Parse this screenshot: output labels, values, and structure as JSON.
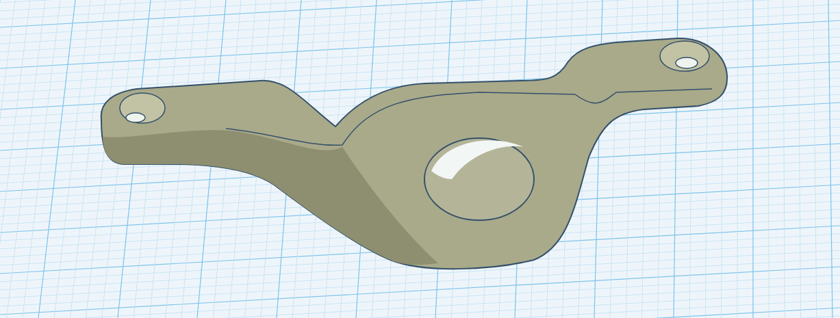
{
  "viewport": {
    "kind": "workplane"
  }
}
